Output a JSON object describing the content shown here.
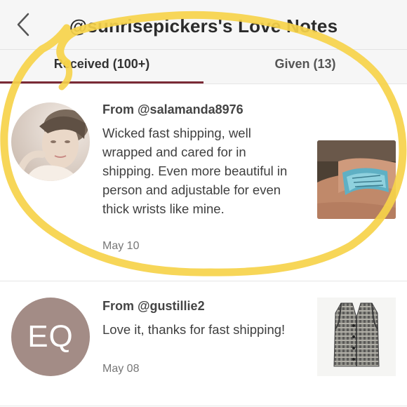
{
  "header": {
    "back_icon": "chevron-left-icon",
    "title": "@sunrisepickers's Love Notes"
  },
  "tabs": [
    {
      "label": "Received (100+)",
      "active": true
    },
    {
      "label": "Given (13)",
      "active": false
    }
  ],
  "notes": [
    {
      "from": "From @salamanda8976",
      "message": "Wicked fast shipping, well wrapped and cared for in shipping. Even more beautiful in person and adjustable for even thick wrists like mine.",
      "date": "May 10",
      "avatar_type": "photo",
      "item": "turquoise cuff bracelet photo"
    },
    {
      "from": "From @gustillie2",
      "message": "Love it, thanks for fast shipping!",
      "date": "May 08",
      "avatar_initials": "EQ",
      "avatar_color": "#a38c86",
      "item": "plaid button vest photo"
    }
  ],
  "colors": {
    "accent": "#7a2a36",
    "highlight_circle": "#f6d34a"
  }
}
